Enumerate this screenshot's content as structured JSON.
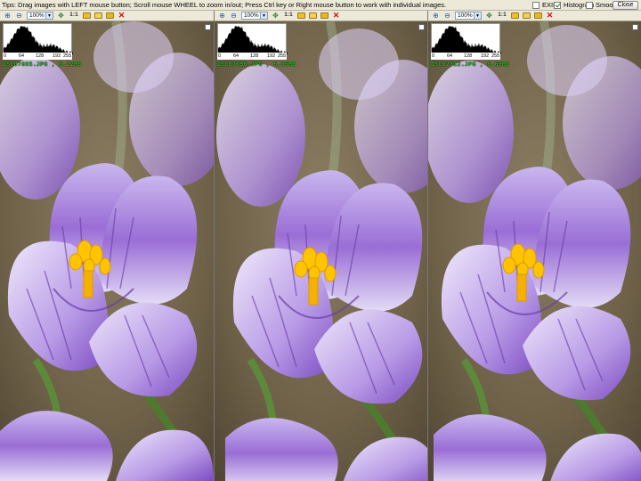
{
  "app": {
    "tips": "Tips: Drag images with LEFT mouse button; Scroll mouse WHEEL to zoom in/out; Press Ctrl key or Right mouse button to work with individual images.",
    "options": [
      {
        "label": "EXIF",
        "checked": false
      },
      {
        "label": "Histogram",
        "checked": true
      },
      {
        "label": "Smooth",
        "checked": false
      }
    ],
    "close_label": "Close"
  },
  "toolbar": {
    "zoom_in_icon": "zoom-in-icon",
    "zoom_out_icon": "zoom-out-icon",
    "zoom_value": "100%",
    "dropdown_glyph": "▼",
    "fit_icon": "move-icon",
    "one_to_one_label": "1:1",
    "open_icon": "folder-icon",
    "delete_glyph": "✕"
  },
  "histogram": {
    "ticks": [
      "0",
      "64",
      "128",
      "192",
      "255"
    ]
  },
  "panels": [
    {
      "filename": "DSC07695.JPG , 6.22MB"
    },
    {
      "filename": "DSC07696.JPG , 6.35MB"
    },
    {
      "filename": "DSC07812.JPG , 6.69MB"
    }
  ],
  "colors": {
    "filename_text": "#22c622",
    "petal_purple": "#8a5cc8",
    "stamen_yellow": "#ffc400",
    "background_brown": "#6e6148",
    "ui_face": "#ece9d8"
  }
}
